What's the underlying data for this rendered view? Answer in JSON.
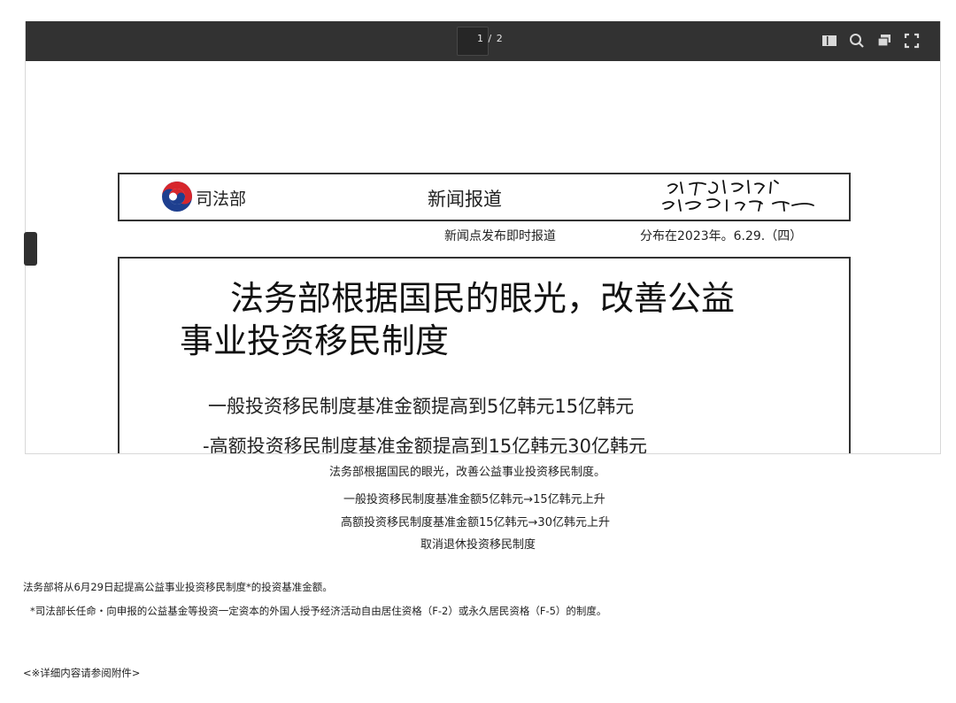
{
  "viewer": {
    "page_indicator": "1 / 2",
    "toolbar_icons": [
      "sidebar-toggle-icon",
      "search-icon",
      "presentation-icon",
      "fullscreen-icon"
    ]
  },
  "document": {
    "ministry_name": "司法部",
    "press_release_label": "新闻报道",
    "slogan_handwritten": "다시 대한민국! 새로운 국민의 나라",
    "release_timing": "新闻点发布即时报道",
    "release_date": "分布在2023年。6.29.（四）",
    "title_line1": "法务部根据国民的眼光，改善公益",
    "title_line2": "事业投资移民制度",
    "subtitle_1": "一般投资移民制度基准金额提高到5亿韩元15亿韩元",
    "subtitle_2": "-高额投资移民制度基准金额提高到15亿韩元30亿韩元"
  },
  "summary": {
    "headline": "法务部根据国民的眼光，改善公益事业投资移民制度。",
    "bullet_1": "一般投资移民制度基准金额5亿韩元→15亿韩元上升",
    "bullet_2": "高额投资移民制度基准金额15亿韩元→30亿韩元上升",
    "bullet_3": "取消退休投资移民制度"
  },
  "body": {
    "paragraph": "法务部将从6月29日起提高公益事业投资移民制度*的投资基准金额。",
    "footnote": "*司法部长任命・向申报的公益基金等投资一定资本的外国人授予经济活动自由居住资格（F-2）或永久居民资格（F-5）的制度。",
    "attachment_note": "<※详细内容请参阅附件>"
  }
}
